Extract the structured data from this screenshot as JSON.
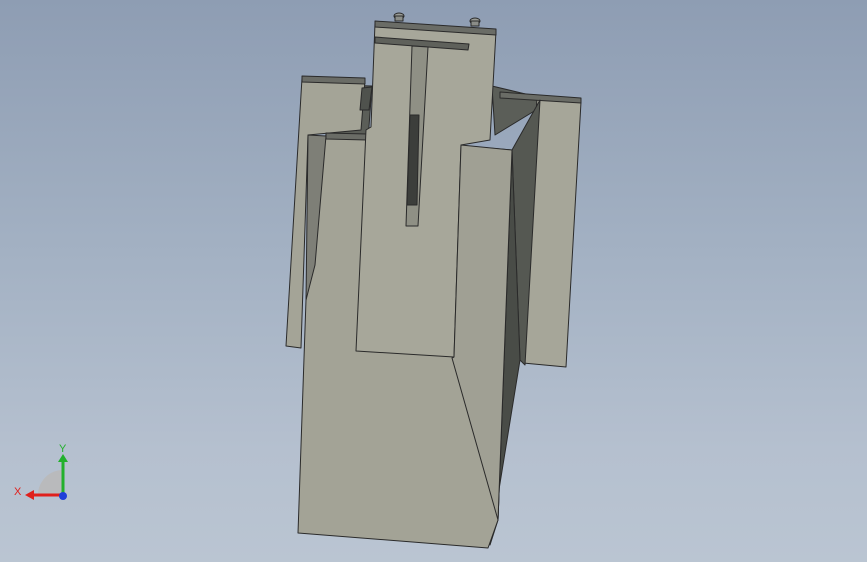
{
  "viewport": {
    "background_top": "#8e9db3",
    "background_bottom": "#bac5d2"
  },
  "model": {
    "face_color": "#a4a497",
    "face_light_color": "#acac9f",
    "shadow_color": "#5b5e58",
    "edge_color": "#2a2a2a"
  },
  "triad": {
    "x_label": "X",
    "y_label": "Y",
    "x_color": "#e0201c",
    "y_color": "#22b02c",
    "z_color": "#1f3fd9"
  }
}
